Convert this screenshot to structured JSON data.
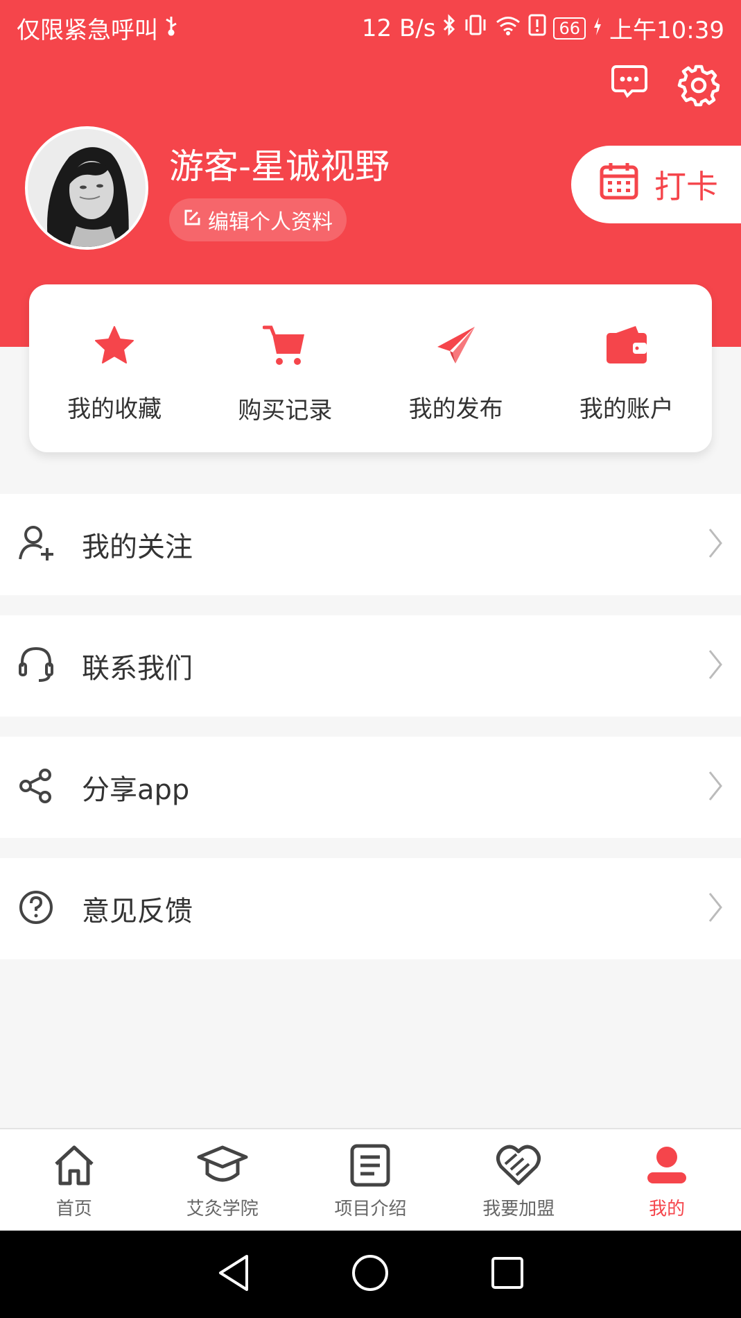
{
  "status_bar": {
    "carrier": "仅限紧急呼叫",
    "speed": "12 B/s",
    "battery": "66",
    "time": "上午10:39"
  },
  "profile": {
    "name": "游客-星诚视野",
    "edit_label": "编辑个人资料",
    "checkin_label": "打卡"
  },
  "quick_actions": [
    {
      "label": "我的收藏",
      "icon": "star-icon"
    },
    {
      "label": "购买记录",
      "icon": "cart-icon"
    },
    {
      "label": "我的发布",
      "icon": "paper-plane-icon"
    },
    {
      "label": "我的账户",
      "icon": "wallet-icon"
    }
  ],
  "menu": [
    {
      "label": "我的关注",
      "icon": "user-add-icon"
    },
    {
      "label": "联系我们",
      "icon": "headset-icon"
    },
    {
      "label": "分享app",
      "icon": "share-icon"
    },
    {
      "label": "意见反馈",
      "icon": "question-icon"
    }
  ],
  "tabs": [
    {
      "label": "首页",
      "icon": "home-icon"
    },
    {
      "label": "艾灸学院",
      "icon": "graduation-cap-icon"
    },
    {
      "label": "项目介绍",
      "icon": "document-icon"
    },
    {
      "label": "我要加盟",
      "icon": "handshake-heart-icon"
    },
    {
      "label": "我的",
      "icon": "user-icon",
      "active": true
    }
  ],
  "colors": {
    "accent": "#f5454b",
    "background": "#f6f6f6"
  }
}
